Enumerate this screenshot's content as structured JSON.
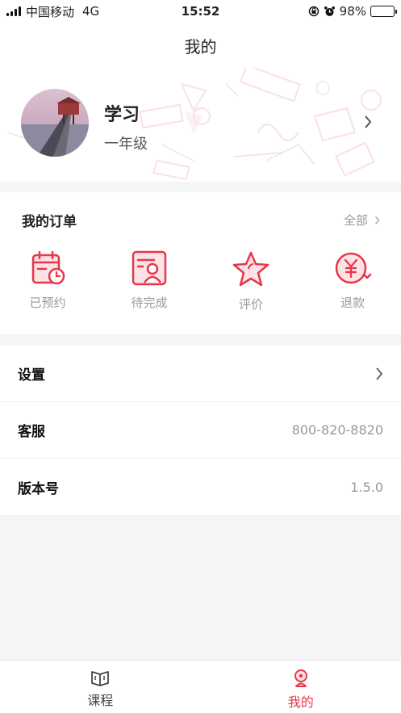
{
  "status_bar": {
    "carrier": "中国移动",
    "network": "4G",
    "time": "15:52",
    "battery": "98%",
    "battery_level": 0.98
  },
  "nav": {
    "title": "我的"
  },
  "profile": {
    "name": "学习",
    "grade": "一年级"
  },
  "orders": {
    "title": "我的订单",
    "all_label": "全部",
    "items": [
      {
        "label": "已预约",
        "icon": "calendar-clock-icon"
      },
      {
        "label": "待完成",
        "icon": "user-card-icon"
      },
      {
        "label": "评价",
        "icon": "star-icon"
      },
      {
        "label": "退款",
        "icon": "yuan-refund-icon"
      }
    ]
  },
  "list": {
    "settings_label": "设置",
    "service_label": "客服",
    "service_value": "800-820-8820",
    "version_label": "版本号",
    "version_value": "1.5.0"
  },
  "tabbar": {
    "tabs": [
      {
        "label": "课程",
        "icon": "book-icon"
      },
      {
        "label": "我的",
        "icon": "person-icon"
      }
    ],
    "active_index": 1
  },
  "colors": {
    "accent": "#e8364a",
    "muted": "#999999",
    "background": "#f5f5f5"
  }
}
